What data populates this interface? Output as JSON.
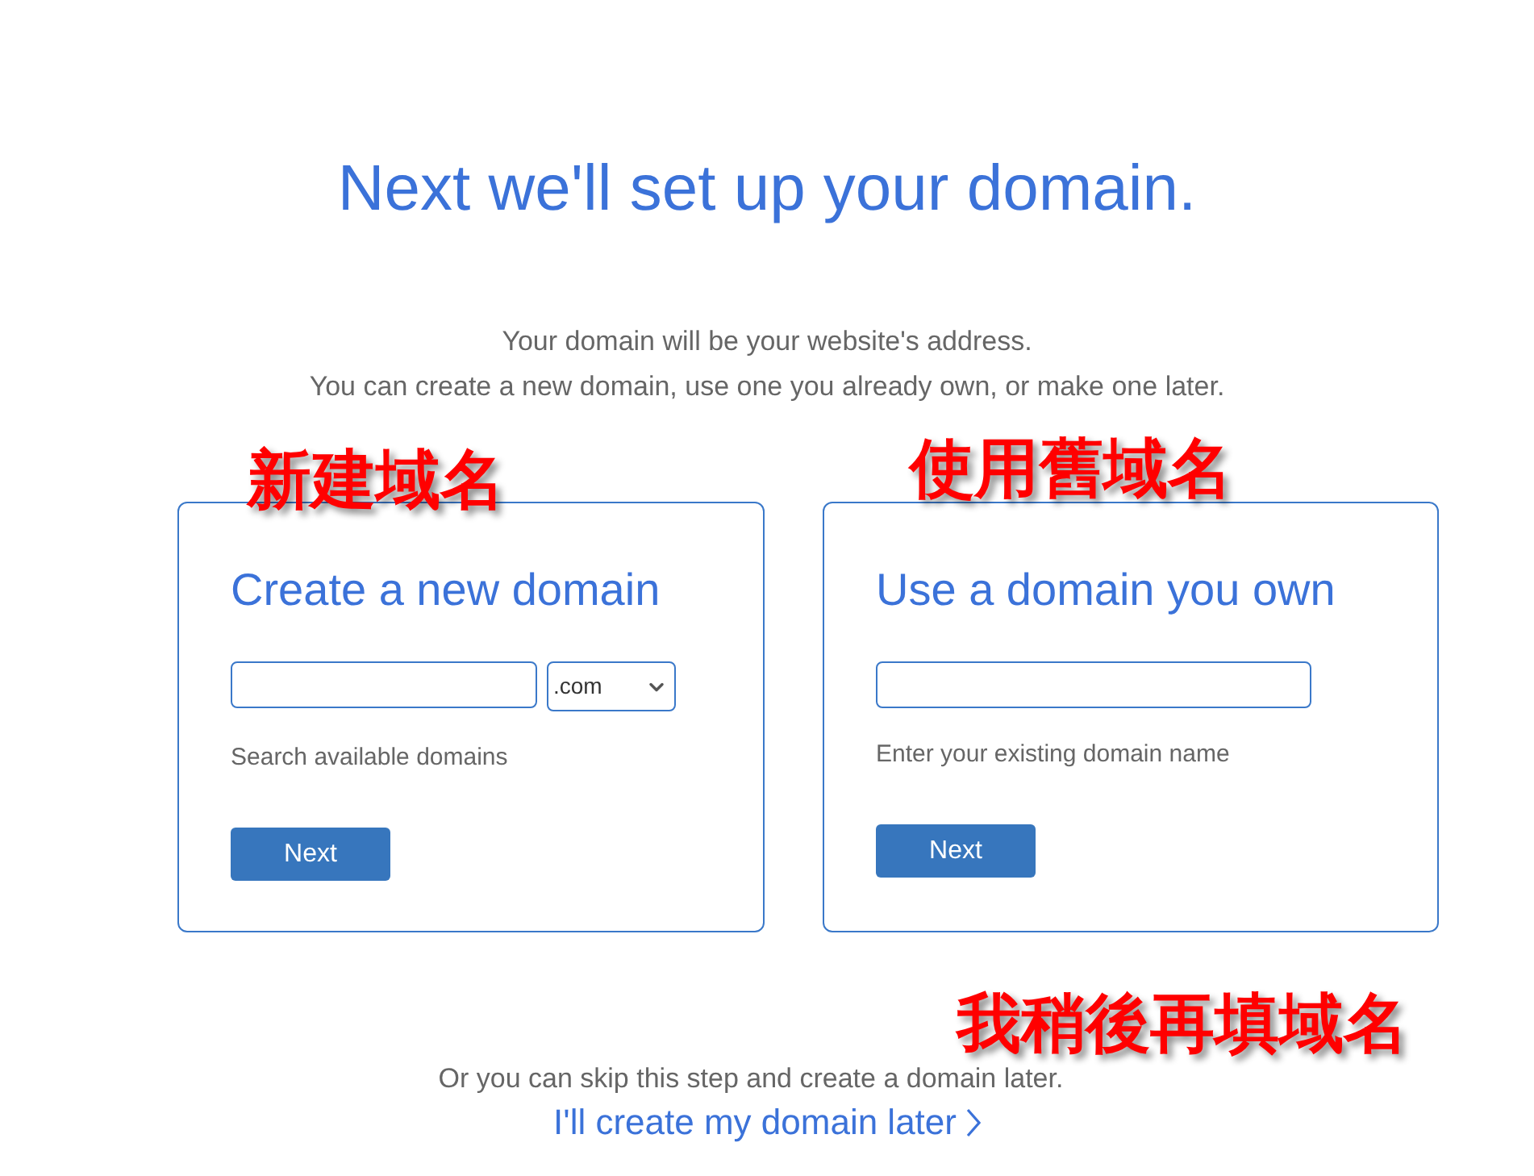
{
  "heading": "Next we'll set up your domain.",
  "intro": [
    "Your domain will be your website's address.",
    "You can create a new domain, use one you already own, or make one later."
  ],
  "options": [
    {
      "kind": "register",
      "annotation": "新建域名",
      "title": "Create a new domain",
      "tld": ".com",
      "hint": "Search available domains",
      "button": "Next"
    },
    {
      "kind": "existing",
      "annotation": "使用舊域名",
      "title": "Use a domain you own",
      "hint": "Enter your existing domain name",
      "button": "Next"
    }
  ],
  "skip": {
    "annotation": "我稍後再填域名",
    "text": "Or you can skip this step and create a domain later.",
    "link": "I'll create my domain later"
  }
}
